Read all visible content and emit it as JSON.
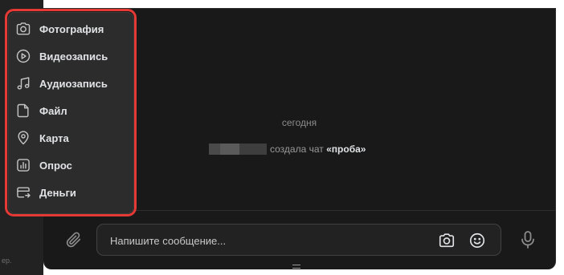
{
  "attach_menu": {
    "items": [
      {
        "label": "Фотография",
        "icon": "camera-icon"
      },
      {
        "label": "Видеозапись",
        "icon": "video-play-icon"
      },
      {
        "label": "Аудиозапись",
        "icon": "music-note-icon"
      },
      {
        "label": "Файл",
        "icon": "file-icon"
      },
      {
        "label": "Карта",
        "icon": "map-pin-icon"
      },
      {
        "label": "Опрос",
        "icon": "poll-chart-icon"
      },
      {
        "label": "Деньги",
        "icon": "money-card-icon"
      }
    ]
  },
  "sidebar": {
    "truncated_text": "ер."
  },
  "chat": {
    "date_separator": "сегодня",
    "service_message": {
      "text": "создала чат",
      "chat_name": "«проба»"
    }
  },
  "composer": {
    "placeholder": "Напишите сообщение..."
  },
  "colors": {
    "background": "#191919",
    "menu_background": "#2c2c2c",
    "highlight": "#e53935",
    "text_primary": "#e1e3e6",
    "text_secondary": "#8c8c8c"
  }
}
